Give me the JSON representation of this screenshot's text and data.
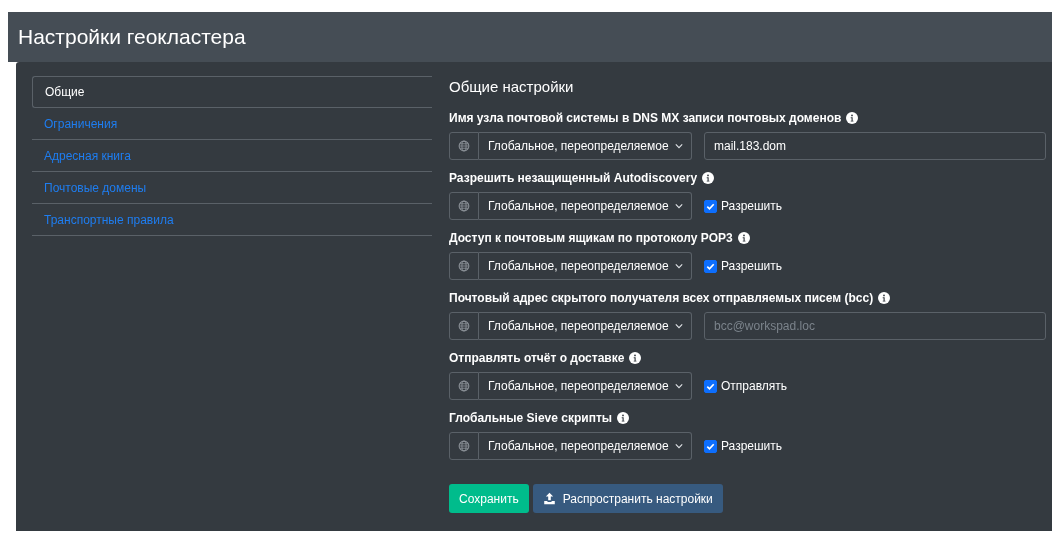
{
  "header": {
    "title": "Настройки геокластера"
  },
  "nav": [
    {
      "label": "Общие",
      "selected": true
    },
    {
      "label": "Ограничения",
      "selected": false
    },
    {
      "label": "Адресная книга",
      "selected": false
    },
    {
      "label": "Почтовые домены",
      "selected": false
    },
    {
      "label": "Транспортные правила",
      "selected": false
    }
  ],
  "section_title": "Общие настройки",
  "settings": [
    {
      "label": "Имя узла почтовой системы в DNS MX записи почтовых доменов",
      "scope": "Глобальное, переопределяемое",
      "kind": "text",
      "value": "mail.183.dom"
    },
    {
      "label": "Разрешить незащищенный Autodiscovery",
      "scope": "Глобальное, переопределяемое",
      "kind": "checkbox",
      "checked": true,
      "checkbox_label": "Разрешить"
    },
    {
      "label": "Доступ к почтовым ящикам по протоколу POP3",
      "scope": "Глобальное, переопределяемое",
      "kind": "checkbox",
      "checked": true,
      "checkbox_label": "Разрешить"
    },
    {
      "label": "Почтовый адрес скрытого получателя всех отправляемых писем (bcc)",
      "scope": "Глобальное, переопределяемое",
      "kind": "text",
      "placeholder": "bcc@workspad.loc"
    },
    {
      "label": "Отправлять отчёт о доставке",
      "scope": "Глобальное, переопределяемое",
      "kind": "checkbox",
      "checked": true,
      "checkbox_label": "Отправлять"
    },
    {
      "label": "Глобальные Sieve скрипты",
      "scope": "Глобальное, переопределяемое",
      "kind": "checkbox",
      "checked": true,
      "checkbox_label": "Разрешить"
    }
  ],
  "buttons": [
    {
      "label": "Сохранить",
      "kind": "save"
    },
    {
      "label": "Распространить настройки",
      "kind": "upload"
    }
  ]
}
